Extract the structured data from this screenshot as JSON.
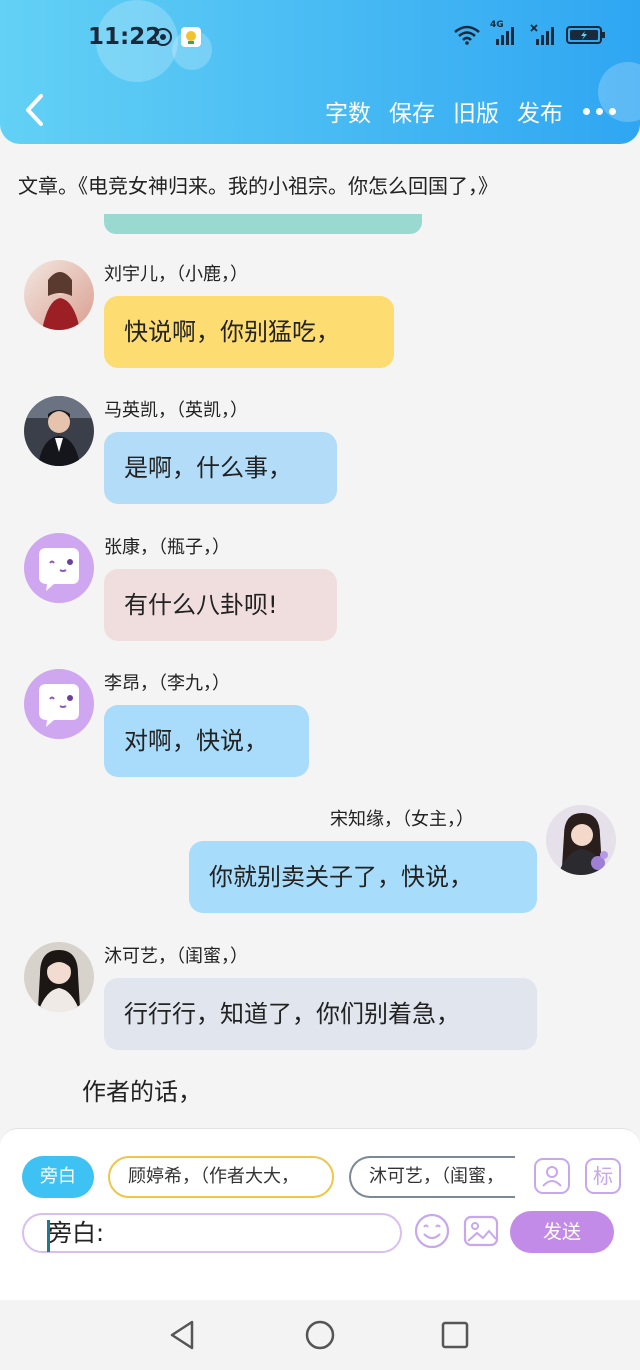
{
  "status_bar": {
    "time": "11:22",
    "network": "4G"
  },
  "toolbar": {
    "word_count": "字数",
    "save": "保存",
    "old_version": "旧版",
    "publish": "发布"
  },
  "article": {
    "title": "文章。《电竞女神归来。我的小祖宗。你怎么回国了，》"
  },
  "messages": [
    {
      "speaker": "刘宇儿，（小鹿，）",
      "text": "快说啊，你别猛吃，",
      "bubble_color": "#fddc72"
    },
    {
      "speaker": "马英凯，（英凯，）",
      "text": "是啊，什么事，",
      "bubble_color": "#b2dcf8"
    },
    {
      "speaker": "张康，（瓶子，）",
      "text": "有什么八卦呗!",
      "bubble_color": "#f0dedf"
    },
    {
      "speaker": "李昂，（李九，）",
      "text": "对啊，快说，",
      "bubble_color": "#a8dcfa"
    },
    {
      "speaker": "宋知缘，（女主，）",
      "text": "你就别卖关子了，快说，",
      "bubble_color": "#a7dcfb"
    },
    {
      "speaker": "沐可艺，（闺蜜，）",
      "text": "行行行，知道了，你们别着急，",
      "bubble_color": "#e1e6ee"
    }
  ],
  "author_note": "作者的话，",
  "composer": {
    "narration_chip": "旁白",
    "character_chip_1": "顾婷希，（作者大大，",
    "character_chip_2": "沐可艺，（闺蜜，",
    "tag_button": "标",
    "input_value": "旁白:",
    "send": "发送"
  },
  "colors": {
    "header_start": "#63d1f5",
    "header_end": "#2fa6f2",
    "accent_purple": "#c28be8",
    "narration_blue": "#3ec1f3"
  },
  "icons": [
    "back-icon",
    "more-icon",
    "wifi-icon",
    "signal-icon",
    "battery-icon",
    "profile-card-icon",
    "emoji-icon",
    "image-icon",
    "nav-back-icon",
    "nav-home-icon",
    "nav-recents-icon"
  ]
}
